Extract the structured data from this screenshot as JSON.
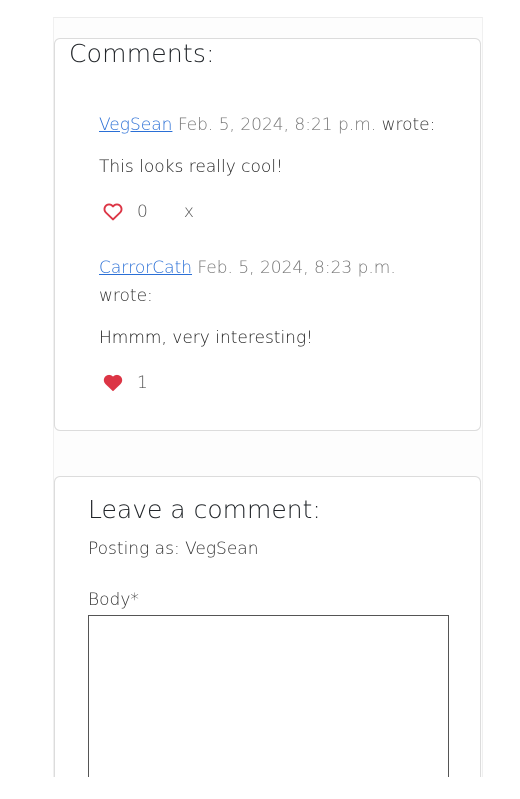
{
  "comments_section": {
    "title": "Comments:",
    "comments": [
      {
        "author": "VegSean",
        "date": "Feb. 5, 2024, 8:21 p.m.",
        "wrote": "wrote:",
        "body": "This looks really cool!",
        "liked": false,
        "likes": "0",
        "delete_label": "x"
      },
      {
        "author": "CarrorCath",
        "date": "Feb. 5, 2024, 8:23 p.m.",
        "wrote": "wrote:",
        "body": "Hmmm, very interesting!",
        "liked": true,
        "likes": "1"
      }
    ]
  },
  "leave_comment": {
    "title": "Leave a comment:",
    "posting_as": "Posting as: VegSean",
    "body_label": "Body*",
    "body_value": ""
  },
  "colors": {
    "link": "#2a6fd6",
    "heart": "#dc3545",
    "card_border": "#dcdcdc"
  },
  "icons": {
    "unliked": "heart-outline-icon",
    "liked": "heart-filled-icon"
  }
}
